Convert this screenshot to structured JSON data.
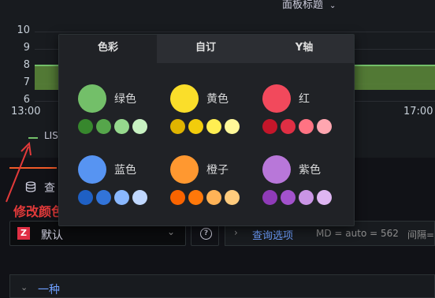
{
  "panel": {
    "title": "面板标题",
    "y_ticks": [
      "10",
      "9",
      "8",
      "7",
      "6"
    ],
    "x_ticks": [
      "13:00",
      "17:00"
    ],
    "legend_label": "LIS"
  },
  "query": {
    "tab_label": "查",
    "datasource": "默认",
    "datasource_logo": "Z",
    "options_label": "查询选项",
    "md_text": "MD = auto = 562",
    "interval_text": "间隔=",
    "row_label": "一种"
  },
  "annotation": {
    "text": "修改颜色"
  },
  "picker": {
    "tabs": [
      "色彩",
      "自订",
      "Y轴"
    ],
    "active_tab": "色彩",
    "groups": [
      {
        "label": "绿色",
        "main": "#73bf69",
        "shades": [
          "#37872d",
          "#56a64b",
          "#96d98d",
          "#c8f2c2"
        ]
      },
      {
        "label": "黄色",
        "main": "#fade2a",
        "shades": [
          "#e0b400",
          "#f2cc0c",
          "#ffee52",
          "#fff899"
        ]
      },
      {
        "label": "红",
        "main": "#f2495c",
        "shades": [
          "#c4162a",
          "#e02f44",
          "#ff7383",
          "#ffa6b0"
        ]
      },
      {
        "label": "蓝色",
        "main": "#5794f2",
        "shades": [
          "#1f60c4",
          "#3274d9",
          "#8ab8ff",
          "#c0d8ff"
        ]
      },
      {
        "label": "橙子",
        "main": "#ff9830",
        "shades": [
          "#fa6400",
          "#ff780a",
          "#ffb357",
          "#ffcb7d"
        ]
      },
      {
        "label": "紫色",
        "main": "#b877d9",
        "shades": [
          "#8f3bb8",
          "#a352cc",
          "#ca95e5",
          "#deb6f2"
        ]
      }
    ]
  }
}
